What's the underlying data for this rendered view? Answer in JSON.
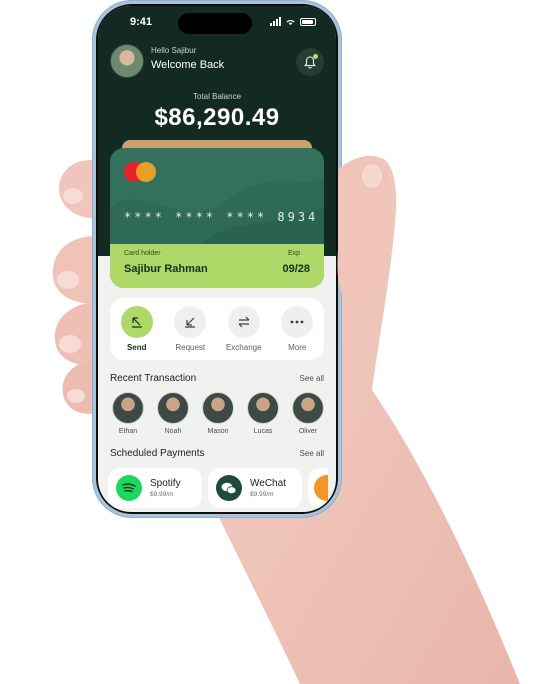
{
  "status_bar": {
    "time": "9:41"
  },
  "header": {
    "greeting": "Hello Sajibur",
    "welcome": "Welcome Back"
  },
  "balance": {
    "label": "Total Balance",
    "amount": "$86,290.49"
  },
  "card": {
    "number_masked": "****  ****  ****  8934",
    "holder_label": "Card holder",
    "holder_name": "Sajibur Rahman",
    "exp_label": "Exp",
    "exp_value": "09/28",
    "brand": "mastercard"
  },
  "actions": [
    {
      "label": "Send",
      "icon": "send-arrow-icon",
      "active": true
    },
    {
      "label": "Request",
      "icon": "request-arrow-icon",
      "active": false
    },
    {
      "label": "Exchange",
      "icon": "exchange-icon",
      "active": false
    },
    {
      "label": "More",
      "icon": "more-dots-icon",
      "active": false
    }
  ],
  "recent": {
    "title": "Recent Transaction",
    "see_all": "See all",
    "people": [
      {
        "name": "Ethan"
      },
      {
        "name": "Noah"
      },
      {
        "name": "Mason"
      },
      {
        "name": "Lucas"
      },
      {
        "name": "Oliver"
      }
    ]
  },
  "scheduled": {
    "title": "Scheduled Payments",
    "see_all": "See all",
    "items": [
      {
        "name": "Spotify",
        "price": "$9.99/m",
        "color": "#1ed760"
      },
      {
        "name": "WeChat",
        "price": "$9.99/m",
        "color": "#1f4a3a"
      }
    ]
  },
  "colors": {
    "dark_green": "#132a22",
    "card_green": "#2f6a55",
    "lime": "#aed868",
    "accent_gold": "#c9a26e"
  }
}
